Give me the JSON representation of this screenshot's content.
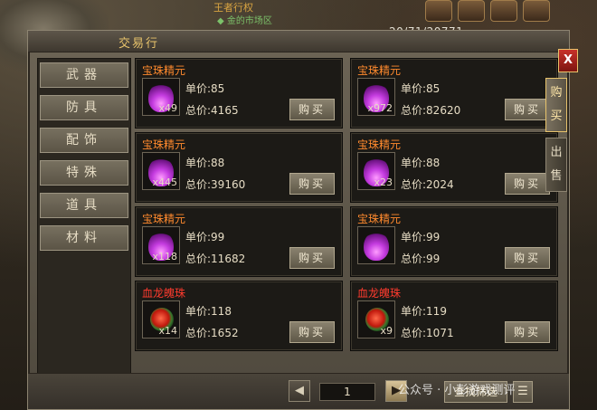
{
  "hud": {
    "title": "王者行权",
    "subtitle": "◆ 金的市场区",
    "coords": "20/71/20771"
  },
  "window": {
    "title": "交易行",
    "close_label": "X"
  },
  "categories": [
    {
      "label": "武器"
    },
    {
      "label": "防具"
    },
    {
      "label": "配饰"
    },
    {
      "label": "特殊"
    },
    {
      "label": "道具"
    },
    {
      "label": "材料"
    }
  ],
  "side_tabs": [
    {
      "label": "购买"
    },
    {
      "label": "出售"
    }
  ],
  "price_labels": {
    "unit": "单价:",
    "total": "总价:"
  },
  "buy_label": "购买",
  "items": [
    {
      "name": "宝珠精元",
      "color": "orange",
      "icon": "orb-purple",
      "qty": "x49",
      "unit": "85",
      "total": "4165"
    },
    {
      "name": "宝珠精元",
      "color": "orange",
      "icon": "orb-purple",
      "qty": "x972",
      "unit": "85",
      "total": "82620"
    },
    {
      "name": "宝珠精元",
      "color": "orange",
      "icon": "orb-purple",
      "qty": "x445",
      "unit": "88",
      "total": "39160"
    },
    {
      "name": "宝珠精元",
      "color": "orange",
      "icon": "orb-purple",
      "qty": "x23",
      "unit": "88",
      "total": "2024"
    },
    {
      "name": "宝珠精元",
      "color": "orange",
      "icon": "orb-purple",
      "qty": "x118",
      "unit": "99",
      "total": "11682"
    },
    {
      "name": "宝珠精元",
      "color": "orange",
      "icon": "orb-purple",
      "qty": "",
      "unit": "99",
      "total": "99"
    },
    {
      "name": "血龙魄珠",
      "color": "red",
      "icon": "orb-red",
      "qty": "x14",
      "unit": "118",
      "total": "1652"
    },
    {
      "name": "血龙魄珠",
      "color": "red",
      "icon": "orb-red",
      "qty": "x9",
      "unit": "119",
      "total": "1071"
    }
  ],
  "pagination": {
    "page": "1",
    "prev_icon": "arrow-left-icon",
    "next_icon": "arrow-right-icon"
  },
  "search_label": "查找筛选",
  "list_icon": "list-icon",
  "watermark": "公众号 · 小彭游戏测评",
  "colors": {
    "name_orange": "#ff8a2e",
    "name_red": "#ff3b2e",
    "accent_gold": "#e8c36b"
  }
}
